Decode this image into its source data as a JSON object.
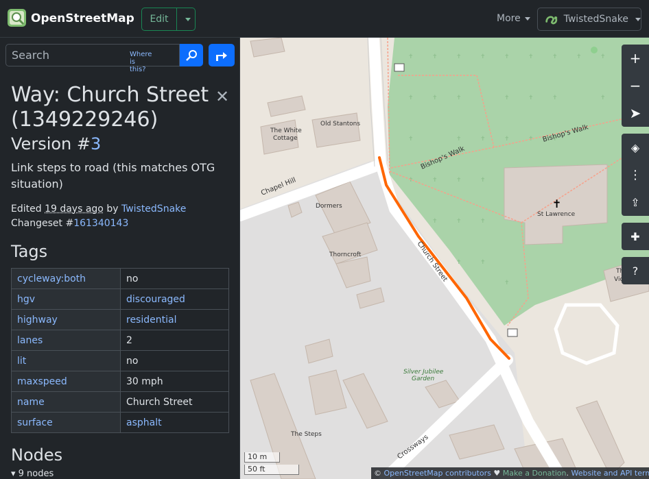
{
  "header": {
    "brand": "OpenStreetMap",
    "edit_label": "Edit",
    "more_label": "More",
    "username": "TwistedSnake"
  },
  "search": {
    "placeholder": "Search",
    "where_is_this": "Where is this?"
  },
  "feature": {
    "title": "Way: Church Street (1349229246)",
    "version_prefix": "Version #",
    "version_number": "3",
    "comment": "Link steps to road (this matches OTG situation)",
    "edited_prefix": "Edited",
    "edited_time": "19 days ago",
    "edited_by": "by",
    "editor": "TwistedSnake",
    "changeset_prefix": "Changeset #",
    "changeset_id": "161340143"
  },
  "tags_heading": "Tags",
  "tags": [
    {
      "key": "cycleway:both",
      "value": "no"
    },
    {
      "key": "hgv",
      "value": "discouraged"
    },
    {
      "key": "highway",
      "value": "residential"
    },
    {
      "key": "lanes",
      "value": "2"
    },
    {
      "key": "lit",
      "value": "no"
    },
    {
      "key": "maxspeed",
      "value": "30 mph"
    },
    {
      "key": "name",
      "value": "Church Street"
    },
    {
      "key": "surface",
      "value": "asphalt"
    }
  ],
  "nodes_heading": "Nodes",
  "nodes_summary": "▾ 9 nodes",
  "map": {
    "labels": {
      "white_cottage_1": "The White",
      "white_cottage_2": "Cottage",
      "old_stantons": "Old Stantons",
      "chapel_hill": "Chapel Hill",
      "dormers": "Dormers",
      "thorncroft": "Thorncroft",
      "church_street": "Church Street",
      "bishops_walk_1": "Bishop's Walk",
      "bishops_walk_2": "Bishop's Walk",
      "st_lawrence": "St Lawrence",
      "old_vicarage_1": "The Old",
      "old_vicarage_2": "Vicarage",
      "jubilee_1": "Silver Jubilee",
      "jubilee_2": "Garden",
      "the_steps": "The Steps",
      "crossways": "Crossways"
    },
    "scale_metric": "10 m",
    "scale_imperial": "50 ft",
    "colors": {
      "highlight": "#ff6600",
      "cemetery": "#aad3a9",
      "building": "#d9d0c9",
      "road": "#ffffff",
      "landuse": "#e0dfdf"
    }
  },
  "controls": [
    "zoom-in",
    "zoom-out",
    "locate",
    "layers",
    "info",
    "share",
    "add-note",
    "query"
  ],
  "attribution": {
    "copyright": "©",
    "osm": "OpenStreetMap contributors",
    "heart": "♥",
    "donate": "Make a Donation",
    "terms": "Website and API terms"
  }
}
